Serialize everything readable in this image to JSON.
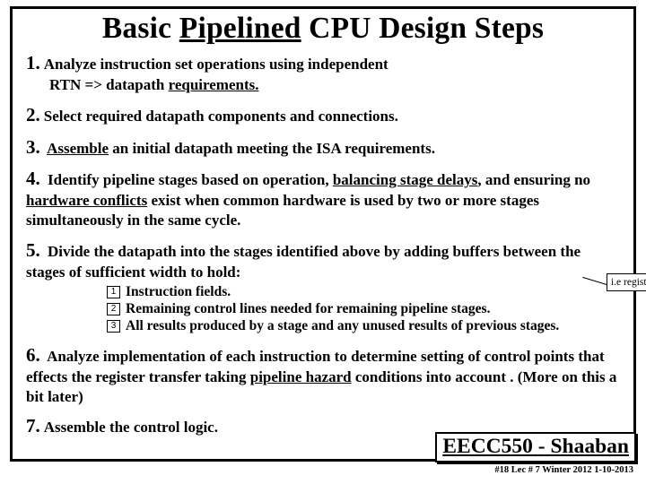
{
  "title_a": "Basic ",
  "title_b": "Pipelined",
  "title_c": " CPU Design Steps",
  "steps": {
    "s1_num": "1.",
    "s1a": "Analyze instruction set operations using independent",
    "s1b_a": "RTN  =>   datapath ",
    "s1b_u": "requirements.",
    "s2_num": "2.",
    "s2": "Select required datapath components and connections.",
    "s3_num": "3.",
    "s3_u": "Assemble",
    "s3_b": " an initial datapath meeting the ISA requirements.",
    "s4_num": "4.",
    "s4_a": "Identify pipeline stages based on operation, ",
    "s4_u1": "balancing stage delays",
    "s4_b": ", and ensuring no ",
    "s4_u2": "hardware conflicts",
    "s4_c": " exist when common hardware is used by two or more stages simultaneously in the same cycle.",
    "s5_num": "5.",
    "s5_a": "Divide the datapath into the stages identified above by adding buffers between the stages of sufficient width to hold:",
    "s5_callout": "i.e registers",
    "s5_sub1_n": "1",
    "s5_sub1": "Instruction fields.",
    "s5_sub2_n": "2",
    "s5_sub2": "Remaining control lines needed for remaining pipeline stages.",
    "s5_sub3_n": "3",
    "s5_sub3": "All results produced by a stage and any unused results of previous stages.",
    "s6_num": "6.",
    "s6_a": "Analyze implementation of each instruction to determine setting of control points that effects the register transfer taking ",
    "s6_u": "pipeline hazard",
    "s6_b": " conditions into account .  (More on this a bit later)",
    "s7_num": "7.",
    "s7": "Assemble the control logic."
  },
  "course_a": "EECC550 ",
  "course_b": "-",
  "course_c": " Shaaban",
  "footer": "#18  Lec # 7  Winter 2012  1-10-2013"
}
